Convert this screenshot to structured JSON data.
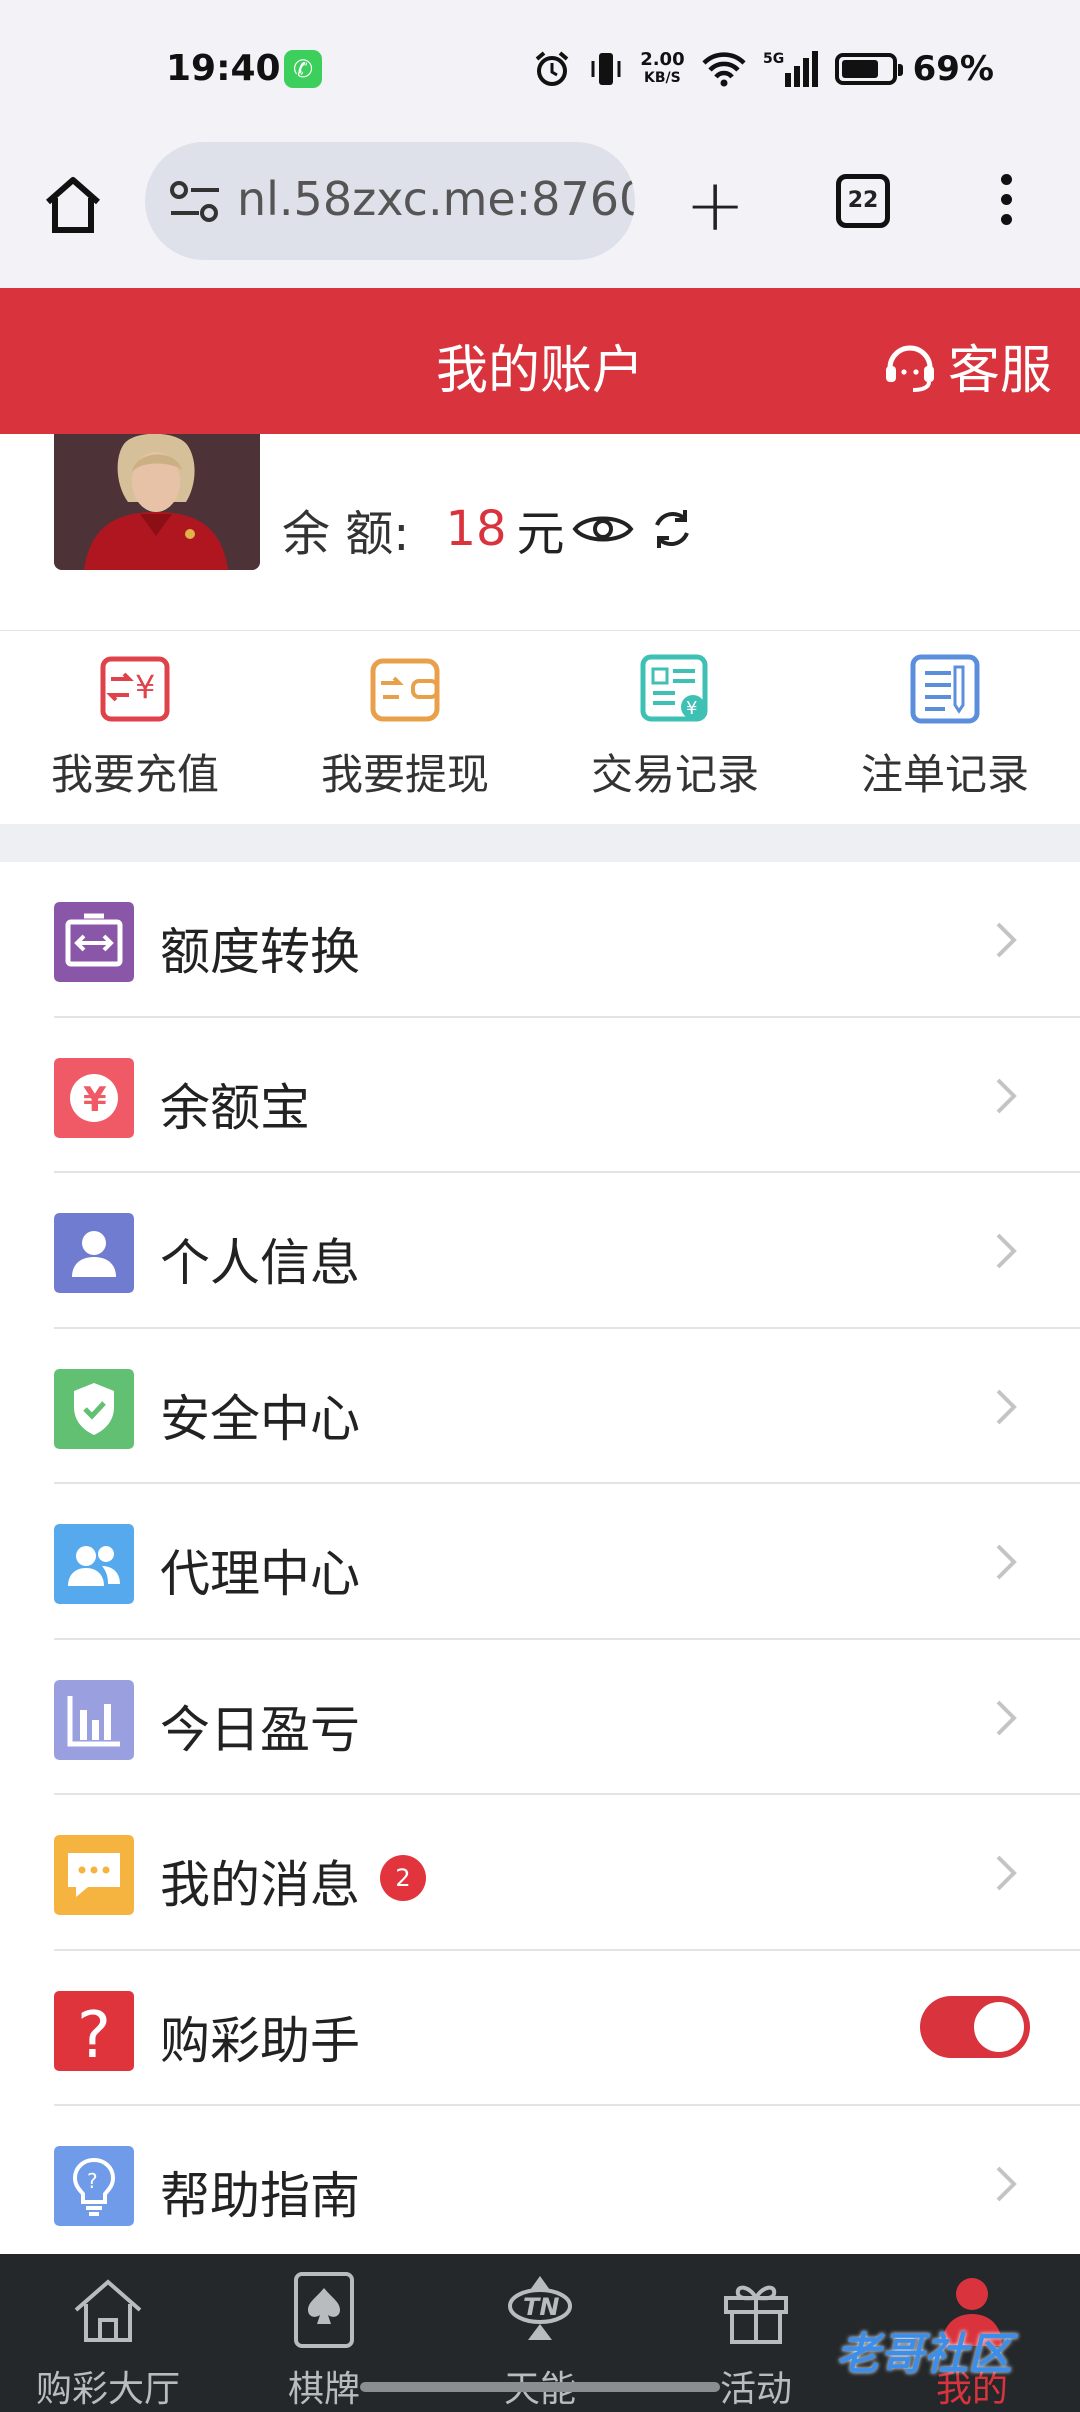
{
  "status_bar": {
    "time": "19:40",
    "speed_value": "2.00",
    "speed_unit": "KB/S",
    "network": "5G",
    "battery": "69%"
  },
  "browser": {
    "url": "nl.58zxc.me:8760",
    "tab_count": "22"
  },
  "header": {
    "title": "我的账户",
    "service_label": "客服"
  },
  "profile": {
    "balance_label": "余 额:",
    "balance_value": "18",
    "balance_unit": "元"
  },
  "quick_actions": [
    {
      "label": "我要充值",
      "icon": "recharge-icon",
      "color": "#e0424b"
    },
    {
      "label": "我要提现",
      "icon": "withdraw-icon",
      "color": "#e9a04a"
    },
    {
      "label": "交易记录",
      "icon": "transaction-record-icon",
      "color": "#3ec1b4"
    },
    {
      "label": "注单记录",
      "icon": "bet-record-icon",
      "color": "#5b8fdc"
    }
  ],
  "menu": [
    {
      "label": "额度转换",
      "icon": "transfer-icon",
      "color": "#8a56a8"
    },
    {
      "label": "余额宝",
      "icon": "yuan-icon",
      "color": "#ef5a66"
    },
    {
      "label": "个人信息",
      "icon": "user-icon",
      "color": "#6f7ccf"
    },
    {
      "label": "安全中心",
      "icon": "shield-icon",
      "color": "#62c072"
    },
    {
      "label": "代理中心",
      "icon": "agents-icon",
      "color": "#55a9ec"
    },
    {
      "label": "今日盈亏",
      "icon": "bar-chart-icon",
      "color": "#9a9fe0"
    },
    {
      "label": "我的消息",
      "icon": "message-icon",
      "color": "#f5b33f",
      "badge": "2"
    },
    {
      "label": "购彩助手",
      "icon": "question-icon",
      "color": "#e0343d",
      "toggle_on": true
    },
    {
      "label": "帮助指南",
      "icon": "bulb-icon",
      "color": "#6f9be8"
    }
  ],
  "tabbar": [
    {
      "label": "购彩大厅",
      "icon": "home-icon",
      "active": false
    },
    {
      "label": "棋牌",
      "icon": "poker-card-icon",
      "active": false
    },
    {
      "label": "天能",
      "icon": "tn-icon",
      "active": false
    },
    {
      "label": "活动",
      "icon": "gift-icon",
      "active": false
    },
    {
      "label": "我的",
      "icon": "profile-icon",
      "active": true
    }
  ],
  "watermark": "老哥社区"
}
